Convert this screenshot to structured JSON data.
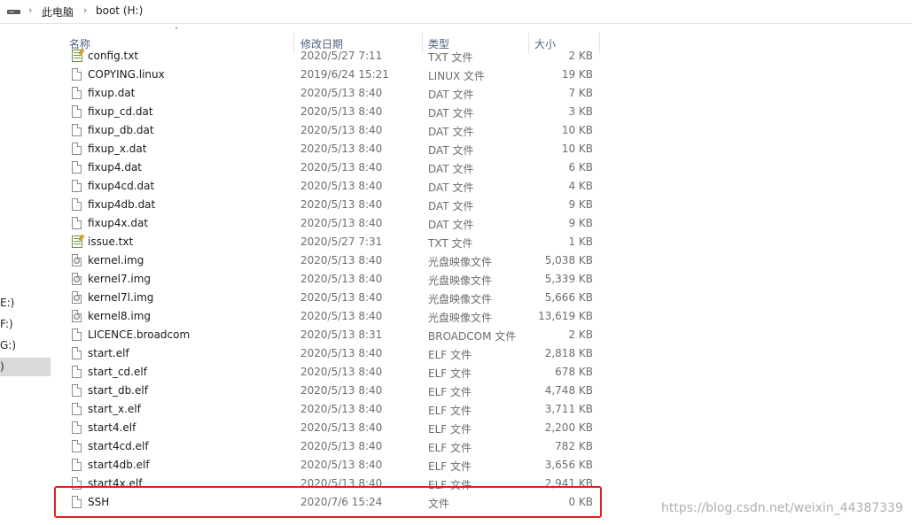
{
  "address_bar": {
    "crumbs": [
      "此电脑",
      "boot (H:)"
    ],
    "separator": "›"
  },
  "nav_pane": {
    "items": [
      {
        "label": "E:)",
        "selected": false
      },
      {
        "label": "F:)",
        "selected": false
      },
      {
        "label": "G:)",
        "selected": false
      },
      {
        "label": ")",
        "selected": true
      }
    ]
  },
  "columns": {
    "name": "名称",
    "modified": "修改日期",
    "type": "类型",
    "size": "大小",
    "sort_indicator": "˄"
  },
  "files": [
    {
      "name": "config.txt",
      "modified": "2020/5/27 7:11",
      "type": "TXT 文件",
      "size": "2 KB",
      "icon": "text-file-icon"
    },
    {
      "name": "COPYING.linux",
      "modified": "2019/6/24 15:21",
      "type": "LINUX 文件",
      "size": "19 KB",
      "icon": "file-icon"
    },
    {
      "name": "fixup.dat",
      "modified": "2020/5/13 8:40",
      "type": "DAT 文件",
      "size": "7 KB",
      "icon": "file-icon"
    },
    {
      "name": "fixup_cd.dat",
      "modified": "2020/5/13 8:40",
      "type": "DAT 文件",
      "size": "3 KB",
      "icon": "file-icon"
    },
    {
      "name": "fixup_db.dat",
      "modified": "2020/5/13 8:40",
      "type": "DAT 文件",
      "size": "10 KB",
      "icon": "file-icon"
    },
    {
      "name": "fixup_x.dat",
      "modified": "2020/5/13 8:40",
      "type": "DAT 文件",
      "size": "10 KB",
      "icon": "file-icon"
    },
    {
      "name": "fixup4.dat",
      "modified": "2020/5/13 8:40",
      "type": "DAT 文件",
      "size": "6 KB",
      "icon": "file-icon"
    },
    {
      "name": "fixup4cd.dat",
      "modified": "2020/5/13 8:40",
      "type": "DAT 文件",
      "size": "4 KB",
      "icon": "file-icon"
    },
    {
      "name": "fixup4db.dat",
      "modified": "2020/5/13 8:40",
      "type": "DAT 文件",
      "size": "9 KB",
      "icon": "file-icon"
    },
    {
      "name": "fixup4x.dat",
      "modified": "2020/5/13 8:40",
      "type": "DAT 文件",
      "size": "9 KB",
      "icon": "file-icon"
    },
    {
      "name": "issue.txt",
      "modified": "2020/5/27 7:31",
      "type": "TXT 文件",
      "size": "1 KB",
      "icon": "text-file-icon"
    },
    {
      "name": "kernel.img",
      "modified": "2020/5/13 8:40",
      "type": "光盘映像文件",
      "size": "5,038 KB",
      "icon": "disc-image-icon"
    },
    {
      "name": "kernel7.img",
      "modified": "2020/5/13 8:40",
      "type": "光盘映像文件",
      "size": "5,339 KB",
      "icon": "disc-image-icon"
    },
    {
      "name": "kernel7l.img",
      "modified": "2020/5/13 8:40",
      "type": "光盘映像文件",
      "size": "5,666 KB",
      "icon": "disc-image-icon"
    },
    {
      "name": "kernel8.img",
      "modified": "2020/5/13 8:40",
      "type": "光盘映像文件",
      "size": "13,619 KB",
      "icon": "disc-image-icon"
    },
    {
      "name": "LICENCE.broadcom",
      "modified": "2020/5/13 8:31",
      "type": "BROADCOM 文件",
      "size": "2 KB",
      "icon": "file-icon"
    },
    {
      "name": "start.elf",
      "modified": "2020/5/13 8:40",
      "type": "ELF 文件",
      "size": "2,818 KB",
      "icon": "file-icon"
    },
    {
      "name": "start_cd.elf",
      "modified": "2020/5/13 8:40",
      "type": "ELF 文件",
      "size": "678 KB",
      "icon": "file-icon"
    },
    {
      "name": "start_db.elf",
      "modified": "2020/5/13 8:40",
      "type": "ELF 文件",
      "size": "4,748 KB",
      "icon": "file-icon"
    },
    {
      "name": "start_x.elf",
      "modified": "2020/5/13 8:40",
      "type": "ELF 文件",
      "size": "3,711 KB",
      "icon": "file-icon"
    },
    {
      "name": "start4.elf",
      "modified": "2020/5/13 8:40",
      "type": "ELF 文件",
      "size": "2,200 KB",
      "icon": "file-icon"
    },
    {
      "name": "start4cd.elf",
      "modified": "2020/5/13 8:40",
      "type": "ELF 文件",
      "size": "782 KB",
      "icon": "file-icon"
    },
    {
      "name": "start4db.elf",
      "modified": "2020/5/13 8:40",
      "type": "ELF 文件",
      "size": "3,656 KB",
      "icon": "file-icon"
    },
    {
      "name": "start4x.elf",
      "modified": "2020/5/13 8:40",
      "type": "ELF 文件",
      "size": "2,941 KB",
      "icon": "file-icon"
    },
    {
      "name": "SSH",
      "modified": "2020/7/6 15:24",
      "type": "文件",
      "size": "0 KB",
      "icon": "file-icon"
    }
  ],
  "highlight_color": "#e02020",
  "watermark": "https://blog.csdn.net/weixin_44387339"
}
